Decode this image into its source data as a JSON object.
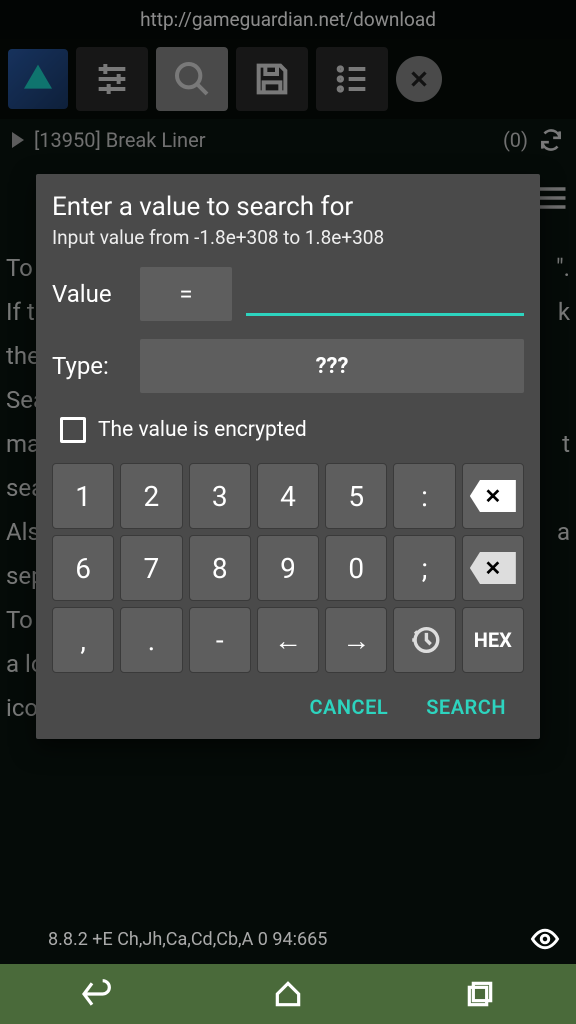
{
  "url": "http://gameguardian.net/download",
  "process": {
    "play": "▶",
    "label": "[13950] Break Liner",
    "count": "(0)"
  },
  "bg_left": "To\nIf t\nthe\nSea\nma\nsea\nAls\nsep\nTo\na lo\nico",
  "bg_right": "\".\nk\n\n\nt\n\na\n\n",
  "modal": {
    "title": "Enter a value to search for",
    "subtitle": "Input value from -1.8e+308 to 1.8e+308",
    "value_label": "Value",
    "eq": "=",
    "value_input": "",
    "type_label": "Type:",
    "type_value": "???",
    "encrypted_label": "The value is encrypted",
    "cancel": "CANCEL",
    "search": "SEARCH"
  },
  "keys": {
    "r1": [
      "1",
      "2",
      "3",
      "4",
      "5",
      ":"
    ],
    "r2": [
      "6",
      "7",
      "8",
      "9",
      "0",
      ";"
    ],
    "r3": [
      ",",
      ".",
      "-",
      "←",
      "→"
    ],
    "hex": "HEX",
    "bksp": "✕"
  },
  "footer": "8.8.2  +E Ch,Jh,Ca,Cd,Cb,A  0  94:665"
}
